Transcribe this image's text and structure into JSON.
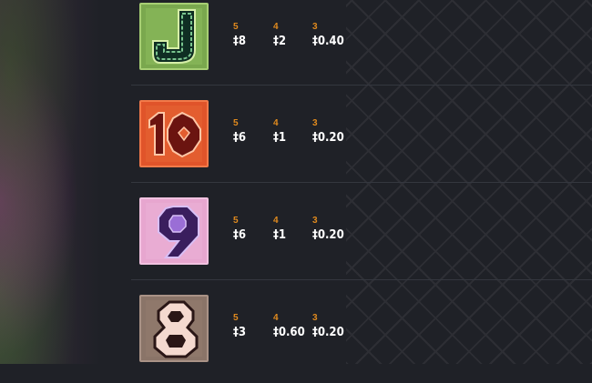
{
  "paytable": {
    "currency": "‡",
    "rows": [
      {
        "symbol": "J",
        "symbol_colors": {
          "bg": "#7aa84e",
          "fill": "#0f2e23",
          "glow": "#cfe8a0"
        },
        "pays": [
          {
            "count": "5",
            "amount": "‡8"
          },
          {
            "count": "4",
            "amount": "‡2"
          },
          {
            "count": "3",
            "amount": "‡0.40"
          }
        ]
      },
      {
        "symbol": "10",
        "symbol_colors": {
          "bg": "#e0542a",
          "fill": "#6b1410",
          "glow": "#ffb08a"
        },
        "pays": [
          {
            "count": "5",
            "amount": "‡6"
          },
          {
            "count": "4",
            "amount": "‡1"
          },
          {
            "count": "3",
            "amount": "‡0.20"
          }
        ]
      },
      {
        "symbol": "9",
        "symbol_colors": {
          "bg": "#e7a6cf",
          "fill": "#3a1e5e",
          "glow": "#c9a6ef"
        },
        "pays": [
          {
            "count": "5",
            "amount": "‡6"
          },
          {
            "count": "4",
            "amount": "‡1"
          },
          {
            "count": "3",
            "amount": "‡0.20"
          }
        ]
      },
      {
        "symbol": "8",
        "symbol_colors": {
          "bg": "#8a7468",
          "fill": "#2a1616",
          "glow": "#f4d9cf"
        },
        "pays": [
          {
            "count": "5",
            "amount": "‡3"
          },
          {
            "count": "4",
            "amount": "‡0.60"
          },
          {
            "count": "3",
            "amount": "‡0.20"
          }
        ]
      }
    ]
  }
}
